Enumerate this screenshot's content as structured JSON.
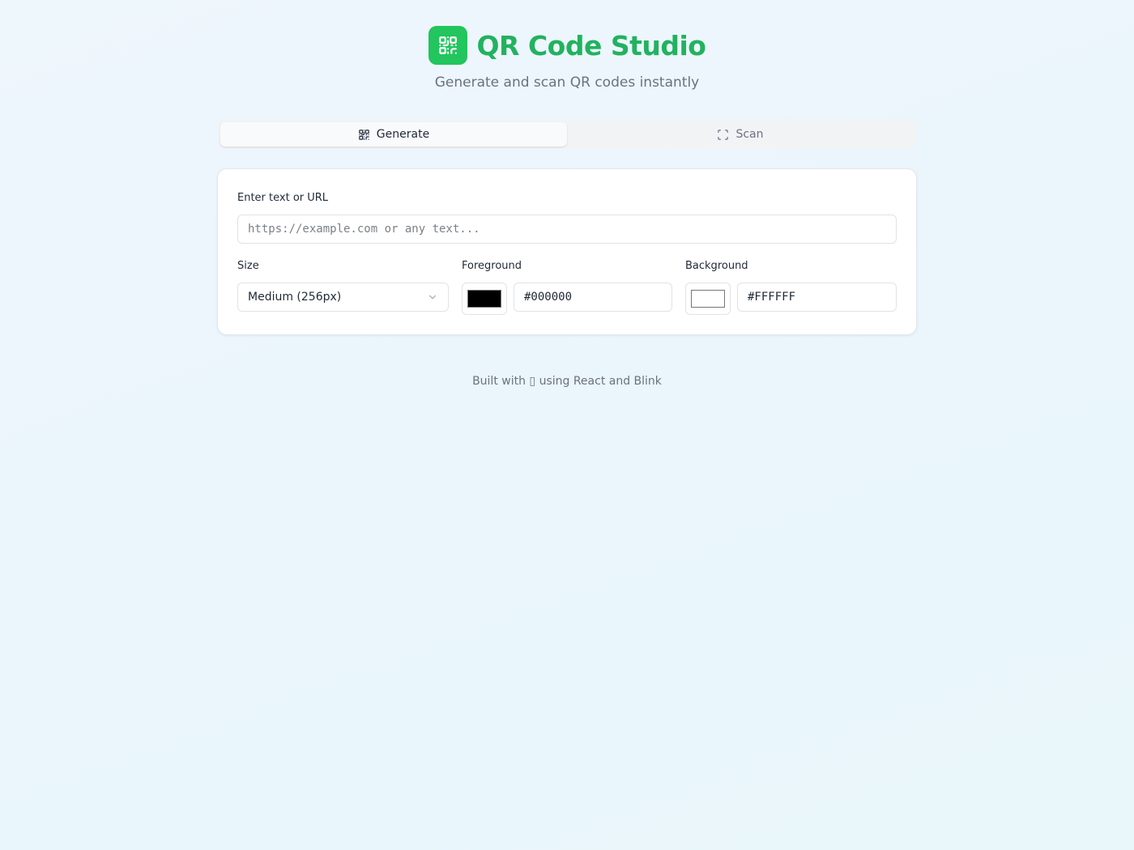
{
  "header": {
    "title": "QR Code Studio",
    "subtitle": "Generate and scan QR codes instantly",
    "logo_icon": "qr-code-icon"
  },
  "tabs": [
    {
      "label": "Generate",
      "icon": "qr-code-icon",
      "active": true
    },
    {
      "label": "Scan",
      "icon": "scan-frame-icon",
      "active": false
    }
  ],
  "form": {
    "text_label": "Enter text or URL",
    "text_placeholder": "https://example.com or any text...",
    "text_value": "",
    "size_label": "Size",
    "size_value": "Medium (256px)",
    "foreground_label": "Foreground",
    "foreground_value": "#000000",
    "background_label": "Background",
    "background_value": "#FFFFFF"
  },
  "footer": {
    "text": "Built with ▯ using React and Blink"
  },
  "colors": {
    "accent": "#22c55e",
    "title": "#22b25f",
    "foreground_swatch": "#000000",
    "background_swatch": "#FFFFFF"
  }
}
